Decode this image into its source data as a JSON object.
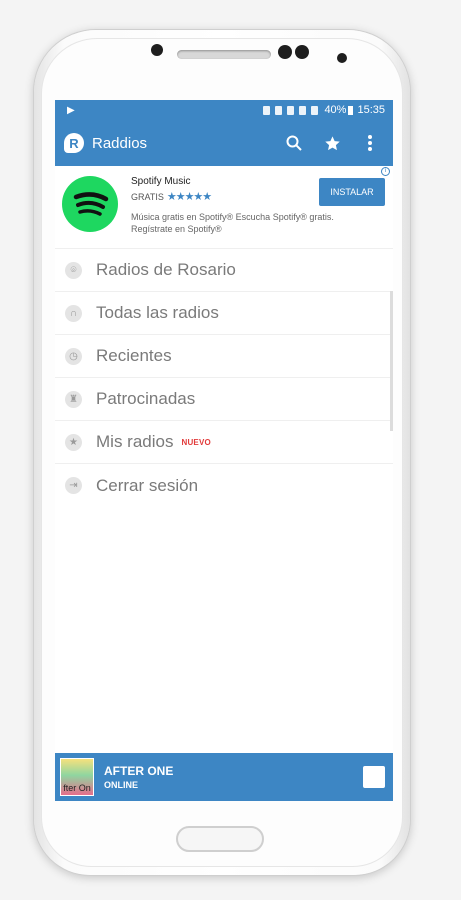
{
  "status_bar": {
    "battery": "40%",
    "time": "15:35"
  },
  "app_bar": {
    "title": "Raddios",
    "logo_letter": "R",
    "actions": [
      "search-icon",
      "star-icon",
      "more-vert-icon"
    ]
  },
  "ad": {
    "app_name": "Spotify Music",
    "price": "GRATIS",
    "rating_stars": "★★★★★",
    "rating_value": 4.5,
    "description": "Música gratis en Spotify® Escucha Spotify® gratis. Regístrate en Spotify®",
    "install_label": "INSTALAR",
    "brand_color": "#1ed760"
  },
  "menu": {
    "items": [
      {
        "label": "Radios de Rosario",
        "icon": "location-pin-icon",
        "badge": ""
      },
      {
        "label": "Todas las radios",
        "icon": "headphones-icon",
        "badge": ""
      },
      {
        "label": "Recientes",
        "icon": "history-icon",
        "badge": ""
      },
      {
        "label": "Patrocinadas",
        "icon": "trophy-icon",
        "badge": ""
      },
      {
        "label": "Mis radios",
        "icon": "star-icon",
        "badge": "NUEVO"
      },
      {
        "label": "Cerrar sesión",
        "icon": "logout-icon",
        "badge": ""
      }
    ]
  },
  "player": {
    "station": "AFTER ONE",
    "status": "ONLINE",
    "thumb_text": "fter On"
  },
  "colors": {
    "accent": "#3d86c4",
    "badge": "#e23b3b"
  }
}
